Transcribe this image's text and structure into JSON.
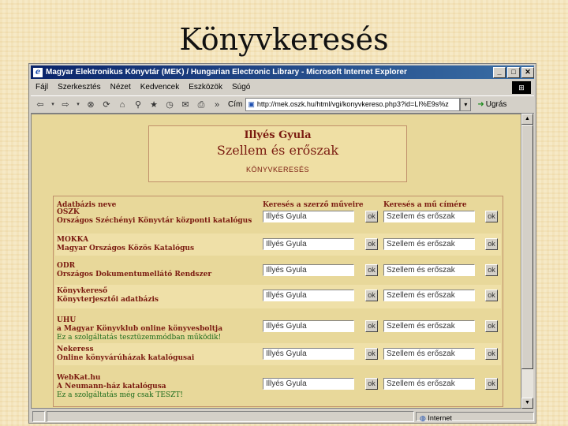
{
  "slide": {
    "title": "Könyvkeresés"
  },
  "window": {
    "title": "Magyar Elektronikus Könyvtár (MEK) / Hungarian Electronic Library - Microsoft Internet Explorer",
    "menu": [
      "Fájl",
      "Szerkesztés",
      "Nézet",
      "Kedvencek",
      "Eszközök",
      "Súgó"
    ],
    "address_label": "Cím",
    "address": "http://mek.oszk.hu/html/vgi/konyvkereso.php3?id=LI%E9s%z",
    "go_label": "Ugrás",
    "status": "Internet"
  },
  "page": {
    "author": "Illyés Gyula",
    "book_title": "Szellem és erőszak",
    "search_heading": "KÖNYVKERESÉS",
    "columns": {
      "database": "Adatbázis neve",
      "author_search": "Keresés a szerző műveire",
      "title_search": "Keresés a mű címére"
    },
    "ok_label": "ok",
    "rows": [
      {
        "name1": "OSZK",
        "name2": "Országos Széchényi Könyvtár központi katalógus",
        "note": "",
        "author": "Illyés Gyula",
        "title": "Szellem és erőszak"
      },
      {
        "name1": "MOKKA",
        "name2": "Magyar Országos Közös Katalógus",
        "note": "",
        "author": "Illyés Gyula",
        "title": "Szellem és erőszak"
      },
      {
        "name1": "ODR",
        "name2": "Országos Dokumentumellátó Rendszer",
        "note": "",
        "author": "Illyés Gyula",
        "title": "Szellem és erőszak"
      },
      {
        "name1": "Könyvkereső",
        "name2": "Könyvterjesztői adatbázis",
        "note": "",
        "author": "Illyés Gyula",
        "title": "Szellem és erőszak"
      },
      {
        "name1": "UHU",
        "name2": "a Magyar Könyvklub online könyvesboltja",
        "note": "Ez a szolgáltatás tesztüzemmódban működik!",
        "author": "Illyés Gyula",
        "title": "Szellem és erőszak"
      },
      {
        "name1": "Nekeress",
        "name2": "Online könyvárúházak katalógusai",
        "note": "",
        "author": "Illyés Gyula",
        "title": "Szellem és erőszak"
      },
      {
        "name1": "WebKat.hu",
        "name2": "A Neumann-ház katalógusa",
        "note": "Ez a szolgáltatás még csak TESZT!",
        "author": "Illyés Gyula",
        "title": "Szellem és erőszak"
      }
    ]
  }
}
